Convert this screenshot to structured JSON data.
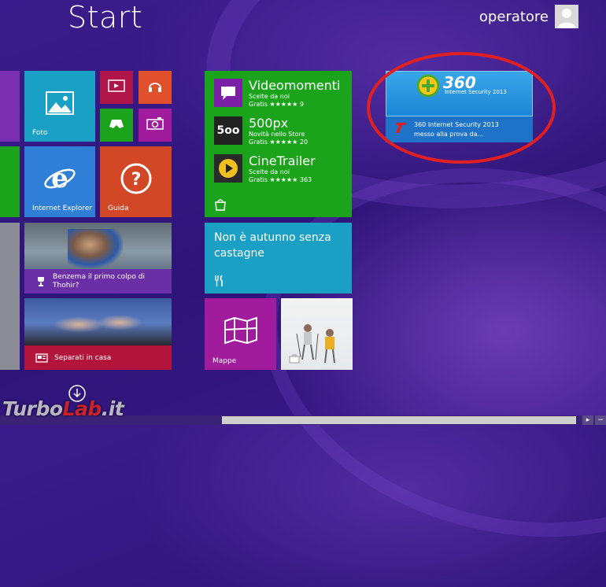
{
  "start": {
    "title": "Start"
  },
  "user": {
    "name": "operatore"
  },
  "tiles": {
    "foto": {
      "label": "Foto"
    },
    "ie": {
      "label": "Internet Explorer"
    },
    "guida": {
      "label": "Guida"
    },
    "sport": {
      "label": "Benzema il primo colpo di Thohir?"
    },
    "news": {
      "label": "Separati in casa"
    },
    "mappe": {
      "label": "Mappe"
    },
    "food": {
      "text": "Non è autunno senza castagne"
    }
  },
  "store": {
    "items": [
      {
        "name": "Videomomenti",
        "sub": "Scelte da noi",
        "rating": "Gratis ★★★★★ 9"
      },
      {
        "name": "500px",
        "sub": "Novità nello Store",
        "rating": "Gratis ★★★★★ 20"
      },
      {
        "name": "CineTrailer",
        "sub": "Scelte da noi",
        "rating": "Gratis ★★★★★ 363"
      }
    ],
    "thumb_500px": "5oo"
  },
  "security_tile": {
    "brand": "360",
    "tagline": "Internet Security 2013",
    "title": "360 Internet Security 2013",
    "subtitle": "messo alla prova da..."
  },
  "watermark": {
    "part1": "Turbo",
    "part2": "Lab",
    "part3": ".it"
  },
  "colors": {
    "background": "#2e1478",
    "green": "#1ba41b",
    "teal": "#1aa0c4",
    "red": "#d24726",
    "magenta": "#a11c9d",
    "purple": "#7a2fb0",
    "annotation": "#e02020"
  }
}
